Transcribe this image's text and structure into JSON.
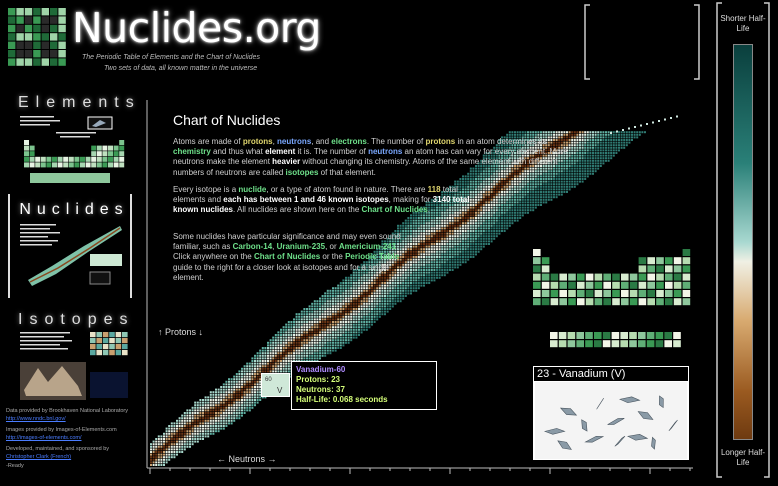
{
  "header": {
    "title": "Nuclides.org",
    "tagline_1": "The Periodic Table of Elements and the Chart of Nuclides",
    "tagline_2": "Two sets of data, all known matter in the universe"
  },
  "sidebar": {
    "elements_title": "Elements",
    "nuclides_title": "Nuclides",
    "isotopes_title": "Isotopes",
    "credits": [
      "Data provided by Brookhaven National Laboratory",
      "http://www.nndc.bnl.gov/",
      "Images provided by Images-of-Elements.com",
      "http://images-of-elements.com/",
      "Developed, maintained, and sponsored by",
      "Christopher Clark (French)",
      "-Ready"
    ]
  },
  "intro": {
    "title": "Chart of Nuclides",
    "p1": [
      {
        "t": "Atoms are made of "
      },
      {
        "t": "protons",
        "c": "hl-y"
      },
      {
        "t": ", "
      },
      {
        "t": "neutrons",
        "c": "hl-b"
      },
      {
        "t": ", and "
      },
      {
        "t": "electrons",
        "c": "hl"
      },
      {
        "t": ". The number of "
      },
      {
        "t": "protons",
        "c": "hl-y"
      },
      {
        "t": " in an atom determines its "
      },
      {
        "t": "chemistry",
        "c": "hl"
      },
      {
        "t": " and thus what "
      },
      {
        "t": "element",
        "c": "hl-w"
      },
      {
        "t": " it is. The number of "
      },
      {
        "t": "neutrons",
        "c": "hl-b"
      },
      {
        "t": " an atom has can vary for every element. More neutrons make the element "
      },
      {
        "t": "heavier",
        "c": "hl-w"
      },
      {
        "t": " without changing its chemistry. Atoms of the same element with different numbers of neutrons are called "
      },
      {
        "t": "isotopes",
        "c": "hl"
      },
      {
        "t": " of that element."
      }
    ],
    "p2": [
      {
        "t": "Every isotope is a "
      },
      {
        "t": "nuclide",
        "c": "hl"
      },
      {
        "t": ", or a type of atom found in nature. There are "
      },
      {
        "t": "118",
        "c": "hl-y"
      },
      {
        "t": " total elements and "
      },
      {
        "t": "each has between 1 and 46 known isotopes",
        "c": "hl-w"
      },
      {
        "t": ", making for "
      },
      {
        "t": "3140 total known nuclides",
        "c": "hl-w"
      },
      {
        "t": ". All nuclides are shown here on the "
      },
      {
        "t": "Chart of Nuclides",
        "c": "hl"
      },
      {
        "t": "."
      }
    ],
    "p3": [
      {
        "t": "Some nuclides have particular significance and may even sound familiar, such as "
      },
      {
        "t": "Carbon-14",
        "c": "hl"
      },
      {
        "t": ", "
      },
      {
        "t": "Uranium-235",
        "c": "hl"
      },
      {
        "t": ", or "
      },
      {
        "t": "Americium-241",
        "c": "hl"
      },
      {
        "t": ". Click anywhere on the "
      },
      {
        "t": "Chart of Nuclides",
        "c": "hl"
      },
      {
        "t": " or the "
      },
      {
        "t": "Periodic Table",
        "c": "hl"
      },
      {
        "t": " guide to the right for a closer look at isotopes and for a single element."
      }
    ]
  },
  "chart": {
    "protons_axis": "↑ Protons ↓",
    "neutrons_axis": "← Neutrons →",
    "hover_cell": {
      "mass": "60",
      "symbol": "V"
    }
  },
  "tooltip": {
    "name": "Vanadium-60",
    "protons": "Protons: 23",
    "neutrons": "Neutrons: 37",
    "half_life": "Half-Life: 0.068 seconds"
  },
  "element_card": {
    "title": "23 - Vanadium (V)"
  },
  "scale": {
    "top_label": "Shorter Half-Life",
    "bottom_label": "Longer Half-Life"
  },
  "colors": {
    "brand_green": "#3a9a54",
    "stable_line": "#5a2a10",
    "tooltip_name": "#b08cff",
    "tooltip_values": "#d6ff7a"
  }
}
